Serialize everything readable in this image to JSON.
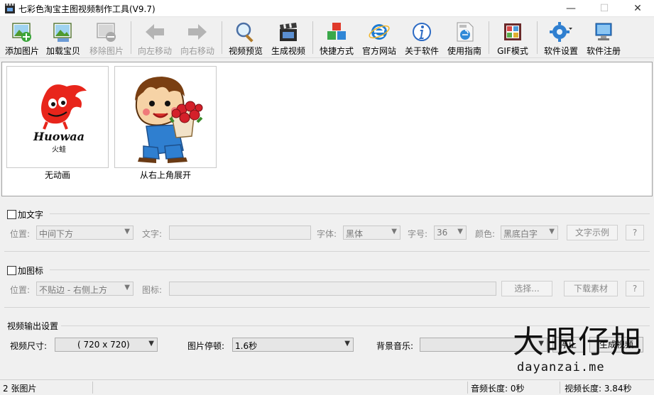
{
  "window": {
    "title": "七彩色淘宝主图视频制作工具(V9.7)",
    "minimize": "—",
    "maximize": "☐",
    "close": "✕"
  },
  "toolbar": {
    "add_image": "添加图片",
    "load_product": "加载宝贝",
    "remove_image": "移除图片",
    "move_left": "向左移动",
    "move_right": "向右移动",
    "preview_video": "视频预览",
    "generate_video": "生成视频",
    "shortcut": "快捷方式",
    "official_site": "官方网站",
    "about": "关于软件",
    "guide": "使用指南",
    "gif_mode": "GIF模式",
    "settings": "软件设置",
    "register": "软件注册"
  },
  "images": [
    {
      "caption": "无动画",
      "logo_text": "Huowaa",
      "logo_sub": "火蛙"
    },
    {
      "caption": "从右上角展开"
    }
  ],
  "text_section": {
    "checkbox_label": "加文字",
    "position_label": "位置:",
    "position_value": "中间下方",
    "text_label": "文字:",
    "font_label": "字体:",
    "font_value": "黑体",
    "size_label": "字号:",
    "size_value": "36",
    "color_label": "颜色:",
    "color_value": "黑底白字",
    "example_button": "文字示例",
    "help_button": "?"
  },
  "icon_section": {
    "checkbox_label": "加图标",
    "position_label": "位置:",
    "position_value": "不贴边 - 右侧上方",
    "icon_label": "图标:",
    "choose_button": "选择...",
    "download_button": "下载素材",
    "help_button": "?"
  },
  "output_section": {
    "heading": "视频输出设置",
    "size_label": "视频尺寸:",
    "size_value": "( 720 x  720)",
    "pause_label": "图片停顿:",
    "pause_value": "1.6秒",
    "music_label": "背景音乐:",
    "music_value": "",
    "stop_button": "停止",
    "generate_button": "生成视频"
  },
  "status": {
    "count": "2 张图片",
    "audio_length": "音频长度: 0秒",
    "video_length": "视频长度: 3.84秒"
  },
  "watermark": {
    "big": "大眼仔旭",
    "small": "dayanzai.me"
  }
}
